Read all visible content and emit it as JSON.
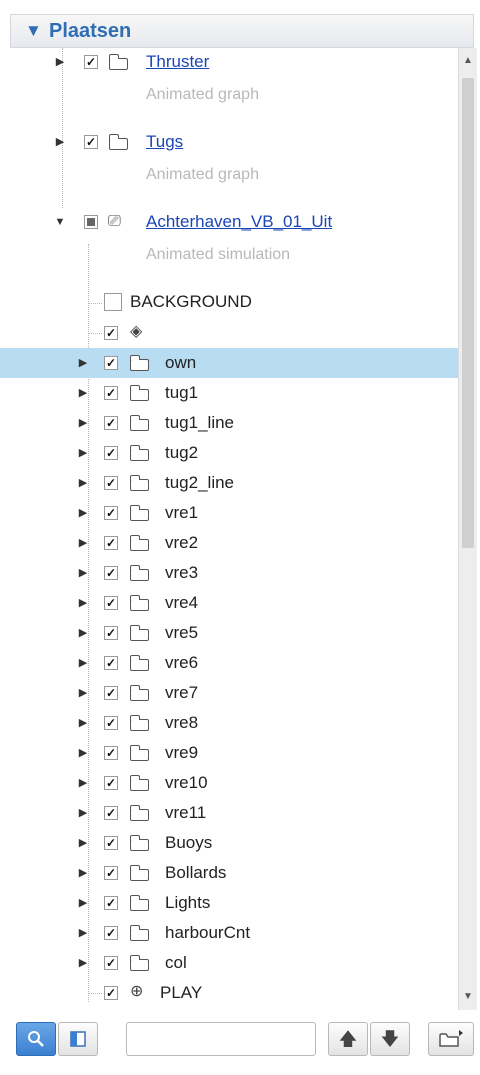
{
  "panel": {
    "title": "Plaatsen",
    "collapse_icon": "triangle-down-icon"
  },
  "tree": {
    "layers": [
      {
        "label": "Thruster",
        "subtitle": "Animated graph",
        "checked": true
      },
      {
        "label": "Tugs",
        "subtitle": "Animated graph",
        "checked": true
      },
      {
        "label": "Achterhaven_VB_01_Uit",
        "subtitle": "Animated simulation",
        "state": "partial"
      }
    ],
    "background": {
      "label": "BACKGROUND",
      "checked": false
    },
    "children": [
      {
        "label": "own",
        "selected": true
      },
      {
        "label": "tug1"
      },
      {
        "label": "tug1_line"
      },
      {
        "label": "tug2"
      },
      {
        "label": "tug2_line"
      },
      {
        "label": "vre1"
      },
      {
        "label": "vre2"
      },
      {
        "label": "vre3"
      },
      {
        "label": "vre4"
      },
      {
        "label": "vre5"
      },
      {
        "label": "vre6"
      },
      {
        "label": "vre7"
      },
      {
        "label": "vre8"
      },
      {
        "label": "vre9"
      },
      {
        "label": "vre10"
      },
      {
        "label": "vre11"
      },
      {
        "label": "Buoys"
      },
      {
        "label": "Bollards"
      },
      {
        "label": "Lights"
      },
      {
        "label": "harbourCnt"
      },
      {
        "label": "col"
      }
    ],
    "play": {
      "label": "PLAY",
      "checked": true
    }
  },
  "toolbar": {
    "search_icon": "magnifier-icon",
    "panel_icon": "split-panel-icon",
    "search_value": "",
    "move_up_icon": "arrow-up-icon",
    "move_down_icon": "arrow-down-icon",
    "folder_icon": "new-folder-icon"
  },
  "colors": {
    "accent": "#2f6db5",
    "selection": "#b8dcf2",
    "link": "#1a46b8",
    "subtitle": "#b8b8b8"
  }
}
